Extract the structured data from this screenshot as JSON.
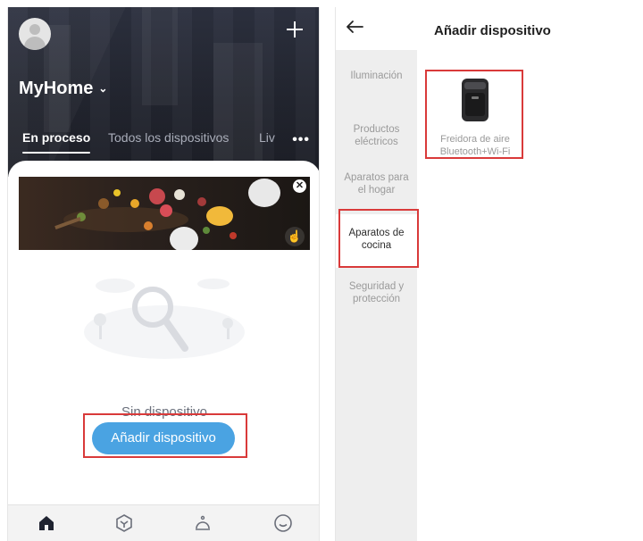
{
  "left_screen": {
    "home_name": "MyHome",
    "home_chevron": "⌄",
    "tabs": [
      {
        "label": "En proceso"
      },
      {
        "label": "Todos los dispositivos"
      },
      {
        "label": "Liv"
      }
    ],
    "more_icon": "•••",
    "banner_close": "✕",
    "banner_hand": "☝",
    "empty_state_text": "Sin dispositivo",
    "add_device_button": "Añadir dispositivo",
    "bottom_nav": [
      {
        "icon": "home-icon"
      },
      {
        "icon": "smart-scene-icon"
      },
      {
        "icon": "service-bell-icon"
      },
      {
        "icon": "profile-smile-icon"
      }
    ],
    "colors": {
      "accent": "#4aa3e2",
      "highlight_box": "#d93a3a",
      "header_dark": "#252833"
    }
  },
  "right_screen": {
    "title": "Añadir dispositivo",
    "categories": [
      {
        "label": "Iluminación"
      },
      {
        "label": "Productos eléctricos"
      },
      {
        "label": "Aparatos para el hogar"
      },
      {
        "label": "Aparatos de cocina"
      },
      {
        "label": "Seguridad y protección"
      }
    ],
    "selected_category": "Aparatos de cocina",
    "devices": [
      {
        "name_line1": "Freidora de aire",
        "name_line2": "Bluetooth+Wi-Fi",
        "icon": "air-fryer-icon"
      }
    ]
  }
}
